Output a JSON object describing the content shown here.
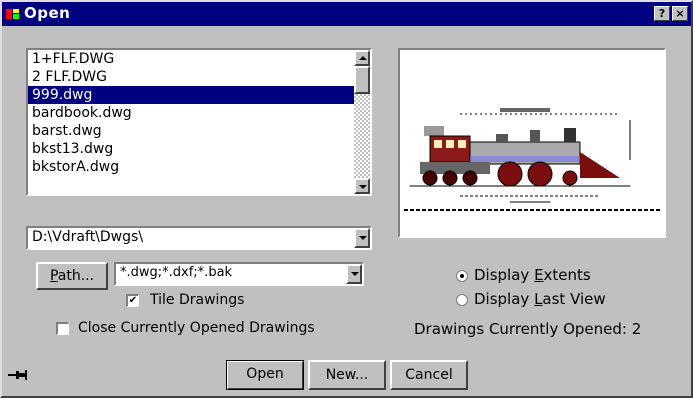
{
  "window": {
    "title": "Open",
    "help_label": "?",
    "close_label": "×"
  },
  "file_list": {
    "items": [
      "1+FLF.DWG",
      "2 FLF.DWG",
      "999.dwg",
      "bardbook.dwg",
      "barst.dwg",
      "bkst13.dwg",
      "bkstorA.dwg"
    ],
    "selected_index": 2
  },
  "directory": {
    "value": "D:\\Vdraft\\Dwgs\\"
  },
  "path_button": {
    "label_first": "P",
    "label_rest": "ath..."
  },
  "filter": {
    "value": "*.dwg;*.dxf;*.bak"
  },
  "tile_drawings": {
    "label": "Tile Drawings",
    "checked": true
  },
  "close_opened": {
    "label": "Close Currently Opened Drawings",
    "checked": false
  },
  "display_extents": {
    "label_pre": "Display ",
    "label_ul": "E",
    "label_post": "xtents",
    "selected": true
  },
  "display_last_view": {
    "label_pre": "Display ",
    "label_ul": "L",
    "label_post": "ast View",
    "selected": false
  },
  "status": {
    "text": "Drawings Currently Opened: 2"
  },
  "buttons": {
    "open": "Open",
    "new": "New...",
    "cancel": "Cancel"
  },
  "colors": {
    "titlebar": "#000080",
    "face": "#c0c0c0",
    "selection": "#000080"
  },
  "icons": {
    "app": "vdraft-app-icon",
    "pin": "pushpin-icon"
  }
}
